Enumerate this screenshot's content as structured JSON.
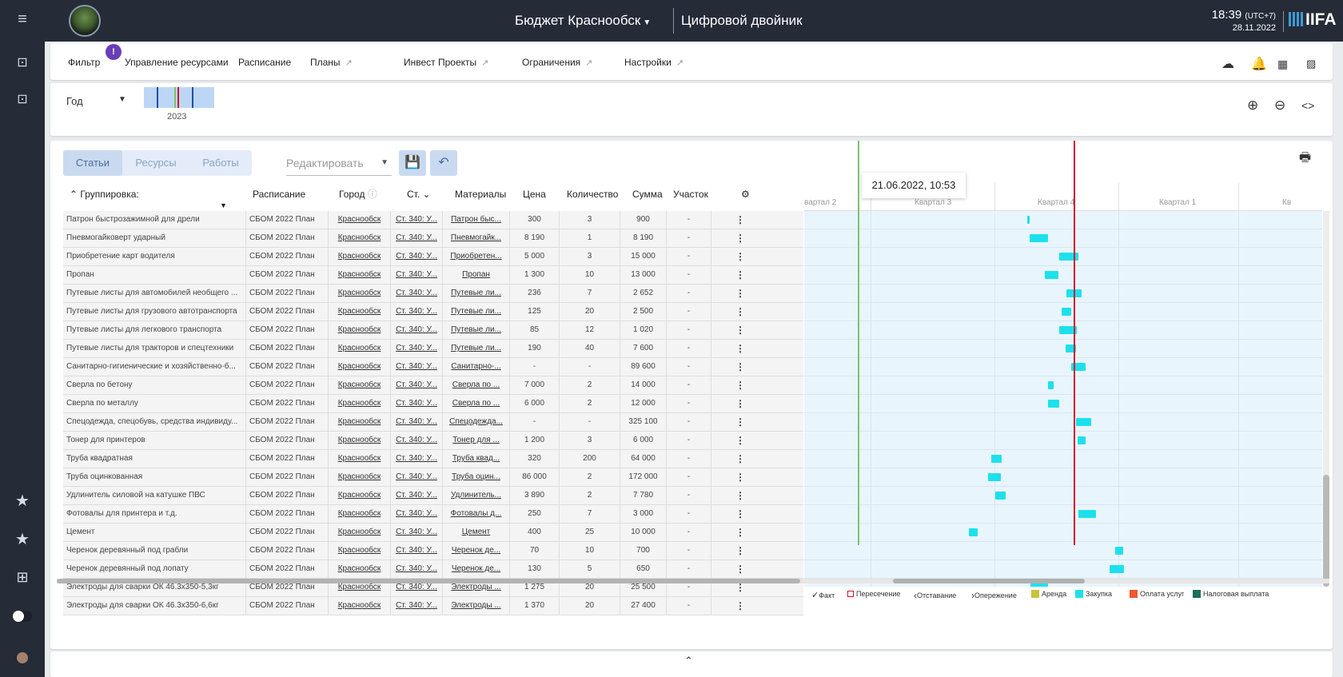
{
  "sidebar": {
    "icons": [
      "menu-icon",
      "scan-icon",
      "scan-alt-icon",
      "star-icon",
      "star-icon",
      "apps-grid-icon",
      "toggle-icon",
      "avatar"
    ]
  },
  "header": {
    "budget": "Бюджет Краснообск",
    "twin": "Цифровой двойник",
    "time": "18:39",
    "tz": "(UTC+7)",
    "date": "28.11.2022",
    "brand": "IIFA"
  },
  "menu": {
    "badge": "!",
    "items": [
      {
        "label": "Фильтр",
        "ext": false
      },
      {
        "label": "Управление ресурсами",
        "ext": false
      },
      {
        "label": "Расписание",
        "ext": false
      },
      {
        "label": "Планы",
        "ext": true
      },
      {
        "label": "Инвест Проекты",
        "ext": true
      },
      {
        "label": "Ограничения",
        "ext": true
      },
      {
        "label": "Настройки",
        "ext": true
      }
    ],
    "right_icons": [
      "cloud-upload-icon",
      "bell-icon",
      "excel-icon",
      "image-icon"
    ]
  },
  "period": {
    "unit": "Год",
    "year": "2023"
  },
  "tabs": [
    "Статьи",
    "Ресурсы",
    "Работы"
  ],
  "edit": {
    "placeholder": "Редактировать"
  },
  "table": {
    "headers": {
      "group": "Группировка:",
      "schedule": "Расписание",
      "city": "Город",
      "st": "Ст.",
      "materials": "Материалы",
      "price": "Цена",
      "qty": "Количество",
      "sum": "Сумма",
      "area": "Участок"
    },
    "rows": [
      [
        "Патрон быстрозажимной для дрели",
        "СБОМ 2022 План",
        "Краснообск",
        "Ст. 340: У...",
        "Патрон быс...",
        "300",
        "3",
        "900",
        "-"
      ],
      [
        "Пневмогайковерт ударный",
        "СБОМ 2022 План",
        "Краснообск",
        "Ст. 340: У...",
        "Пневмогайк...",
        "8 190",
        "1",
        "8 190",
        "-"
      ],
      [
        "Приобретение карт водителя",
        "СБОМ 2022 План",
        "Краснообск",
        "Ст. 340: У...",
        "Приобретен...",
        "5 000",
        "3",
        "15 000",
        "-"
      ],
      [
        "Пропан",
        "СБОМ 2022 План",
        "Краснообск",
        "Ст. 340: У...",
        "Пропан",
        "1 300",
        "10",
        "13 000",
        "-"
      ],
      [
        "Путевые листы для автомобилей необщего ...",
        "СБОМ 2022 План",
        "Краснообск",
        "Ст. 340: У...",
        "Путевые ли...",
        "236",
        "7",
        "2 652",
        "-"
      ],
      [
        "Путевые листы для грузового автотранспорта",
        "СБОМ 2022 План",
        "Краснообск",
        "Ст. 340: У...",
        "Путевые ли...",
        "125",
        "20",
        "2 500",
        "-"
      ],
      [
        "Путевые листы для легкового транспорта",
        "СБОМ 2022 План",
        "Краснообск",
        "Ст. 340: У...",
        "Путевые ли...",
        "85",
        "12",
        "1 020",
        "-"
      ],
      [
        "Путевые листы для тракторов и спецтехники",
        "СБОМ 2022 План",
        "Краснообск",
        "Ст. 340: У...",
        "Путевые ли...",
        "190",
        "40",
        "7 600",
        "-"
      ],
      [
        "Санитарно-гигиенические и хозяйственно-б...",
        "СБОМ 2022 План",
        "Краснообск",
        "Ст. 340: У...",
        "Санитарно-...",
        "-",
        "-",
        "89 600",
        "-"
      ],
      [
        "Сверла по бетону",
        "СБОМ 2022 План",
        "Краснообск",
        "Ст. 340: У...",
        "Сверла по ...",
        "7 000",
        "2",
        "14 000",
        "-"
      ],
      [
        "Сверла по металлу",
        "СБОМ 2022 План",
        "Краснообск",
        "Ст. 340: У...",
        "Сверла по ...",
        "6 000",
        "2",
        "12 000",
        "-"
      ],
      [
        "Спецодежда, спецобувь, средства индивиду...",
        "СБОМ 2022 План",
        "Краснообск",
        "Ст. 340: У...",
        "Спецодежда...",
        "-",
        "-",
        "325 100",
        "-"
      ],
      [
        "Тонер для принтеров",
        "СБОМ 2022 План",
        "Краснообск",
        "Ст. 340: У...",
        "Тонер для ...",
        "1 200",
        "3",
        "6 000",
        "-"
      ],
      [
        "Труба квадратная",
        "СБОМ 2022 План",
        "Краснообск",
        "Ст. 340: У...",
        "Труба квад...",
        "320",
        "200",
        "64 000",
        "-"
      ],
      [
        "Труба оцинкованная",
        "СБОМ 2022 План",
        "Краснообск",
        "Ст. 340: У...",
        "Труба оцин...",
        "86 000",
        "2",
        "172 000",
        "-"
      ],
      [
        "Удлинитель силовой на катушке ПВС",
        "СБОМ 2022 План",
        "Краснообск",
        "Ст. 340: У...",
        "Удлинитель...",
        "3 890",
        "2",
        "7 780",
        "-"
      ],
      [
        "Фотовалы для принтера и т.д.",
        "СБОМ 2022 План",
        "Краснообск",
        "Ст. 340: У...",
        "Фотовалы д...",
        "250",
        "7",
        "3 000",
        "-"
      ],
      [
        "Цемент",
        "СБОМ 2022 План",
        "Краснообск",
        "Ст. 340: У...",
        "Цемент",
        "400",
        "25",
        "10 000",
        "-"
      ],
      [
        "Черенок деревянный под грабли",
        "СБОМ 2022 План",
        "Краснообск",
        "Ст. 340: У...",
        "Черенок де...",
        "70",
        "10",
        "700",
        "-"
      ],
      [
        "Черенок деревянный под лопату",
        "СБОМ 2022 План",
        "Краснообск",
        "Ст. 340: У...",
        "Черенок де...",
        "130",
        "5",
        "650",
        "-"
      ],
      [
        "Электроды для сварки ОК 46.3х350-5,3кг",
        "СБОМ 2022 План",
        "Краснообск",
        "Ст. 340: У...",
        "Электроды ...",
        "1 275",
        "20",
        "25 500",
        "-"
      ],
      [
        "Электроды для сварки ОК 46.3х350-6,6кг",
        "СБОМ 2022 План",
        "Краснообск",
        "Ст. 340: У...",
        "Электроды ...",
        "1 370",
        "20",
        "27 400",
        "-"
      ]
    ]
  },
  "gantt": {
    "quarters": [
      "вартал 2",
      "Квартал 3",
      "Квартал 4",
      "Квартал 1",
      "Кв"
    ],
    "tooltip": "21.06.2022, 10:53",
    "bars": [
      [
        0.43,
        0.005
      ],
      [
        0.435,
        0.035
      ],
      [
        0.492,
        0.037
      ],
      [
        0.465,
        0.025
      ],
      [
        0.506,
        0.03
      ],
      [
        0.497,
        0.018
      ],
      [
        0.493,
        0.033
      ],
      [
        0.505,
        0.02
      ],
      [
        0.516,
        0.027
      ],
      [
        0.471,
        0.01
      ],
      [
        0.47,
        0.022
      ],
      [
        0.524,
        0.03
      ],
      [
        0.528,
        0.015
      ],
      [
        0.361,
        0.02
      ],
      [
        0.355,
        0.025
      ],
      [
        0.369,
        0.02
      ],
      [
        0.53,
        0.034
      ],
      [
        0.318,
        0.017
      ],
      [
        0.6,
        0.016
      ],
      [
        0.59,
        0.028
      ],
      [
        0.437,
        0.033
      ],
      [
        0.448,
        0.012
      ]
    ],
    "colors": {
      "bar": "#1ce1ed",
      "today": "#7ac46a",
      "now": "#d1122e"
    }
  },
  "legend": [
    {
      "label": "Факт",
      "type": "check"
    },
    {
      "label": "Пересечение",
      "type": "box"
    },
    {
      "label": "Отставание",
      "type": "lt"
    },
    {
      "label": "Опережение",
      "type": "gt"
    },
    {
      "label": "Аренда",
      "color": "#c8c23c"
    },
    {
      "label": "Закупка",
      "color": "#1ce1ed"
    },
    {
      "label": "Оплата услуг",
      "color": "#ef5a2e"
    },
    {
      "label": "Налоговая выплата",
      "color": "#1a6e5a"
    }
  ]
}
